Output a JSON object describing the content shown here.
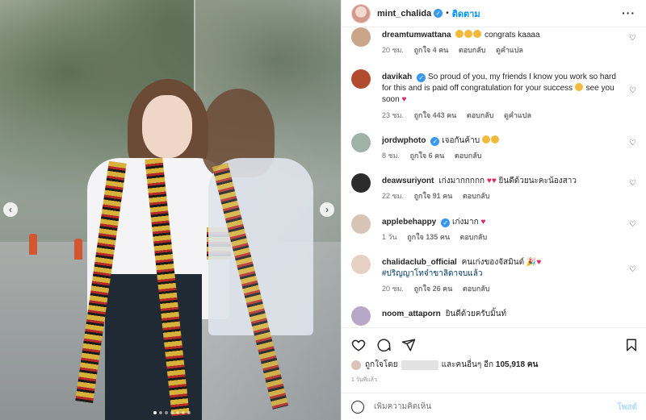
{
  "header": {
    "username": "mint_chalida",
    "follow_label": "ติดตาม",
    "more_icon": "more-horizontal-icon"
  },
  "comments": [
    {
      "user": "dreamtumwattana",
      "text": "congrats kaaaa",
      "emoji_count": 3,
      "time": "20 ชม.",
      "likes": "ถูกใจ 4 คน",
      "reply": "ตอบกลับ",
      "translate": "ดูคำแปล",
      "verified": false
    },
    {
      "user": "davikah",
      "text": "So proud of you, my friends I know you work so hard for this and is paid off congratulation for your success",
      "text_tail": "see you soon",
      "time": "23 ชม.",
      "likes": "ถูกใจ 443 คน",
      "reply": "ตอบกลับ",
      "translate": "ดูคำแปล",
      "verified": true
    },
    {
      "user": "jordwphoto",
      "text": "เจอกันค้าบ",
      "time": "8 ชม.",
      "likes": "ถูกใจ 6 คน",
      "reply": "ตอบกลับ",
      "verified": true
    },
    {
      "user": "deawsuriyont",
      "text": "เก่งมากกกกก",
      "text_tail": "ยินดีด้วยนะคะน้องสาว",
      "time": "22 ชม.",
      "likes": "ถูกใจ 91 คน",
      "reply": "ตอบกลับ",
      "verified": false
    },
    {
      "user": "applebehappy",
      "text": "เก่งมาก",
      "time": "1 วัน",
      "likes": "ถูกใจ 135 คน",
      "reply": "ตอบกลับ",
      "verified": true
    },
    {
      "user": "chalidaclub_official",
      "text": "คนเก่งของจัสมินต์",
      "hashtag": "#ปริญญาโทจ๋าขาลิดาจบแล้ว",
      "time": "20 ชม.",
      "likes": "ถูกใจ 26 คน",
      "reply": "ตอบกลับ",
      "verified": false
    },
    {
      "user": "noom_attaporn",
      "text": "ยินดีด้วยครับมิ้นท์",
      "verified": false
    }
  ],
  "actions": {
    "like_icon": "heart-icon",
    "comment_icon": "comment-icon",
    "share_icon": "send-icon",
    "save_icon": "bookmark-icon"
  },
  "likes_summary": {
    "prefix": "ถูกใจโดย",
    "suffix": "และคนอื่นๆ อีก",
    "count": "105,918 คน"
  },
  "post_date": "1 วันที่แล้ว",
  "comment_box": {
    "placeholder": "เพิ่มความคิดเห็น",
    "post_label": "โพสต์"
  },
  "carousel": {
    "slide_count": 7,
    "active_index": 0
  },
  "colors": {
    "accent": "#0095f6",
    "verified": "#3897f0",
    "heart": "#e0245e"
  }
}
